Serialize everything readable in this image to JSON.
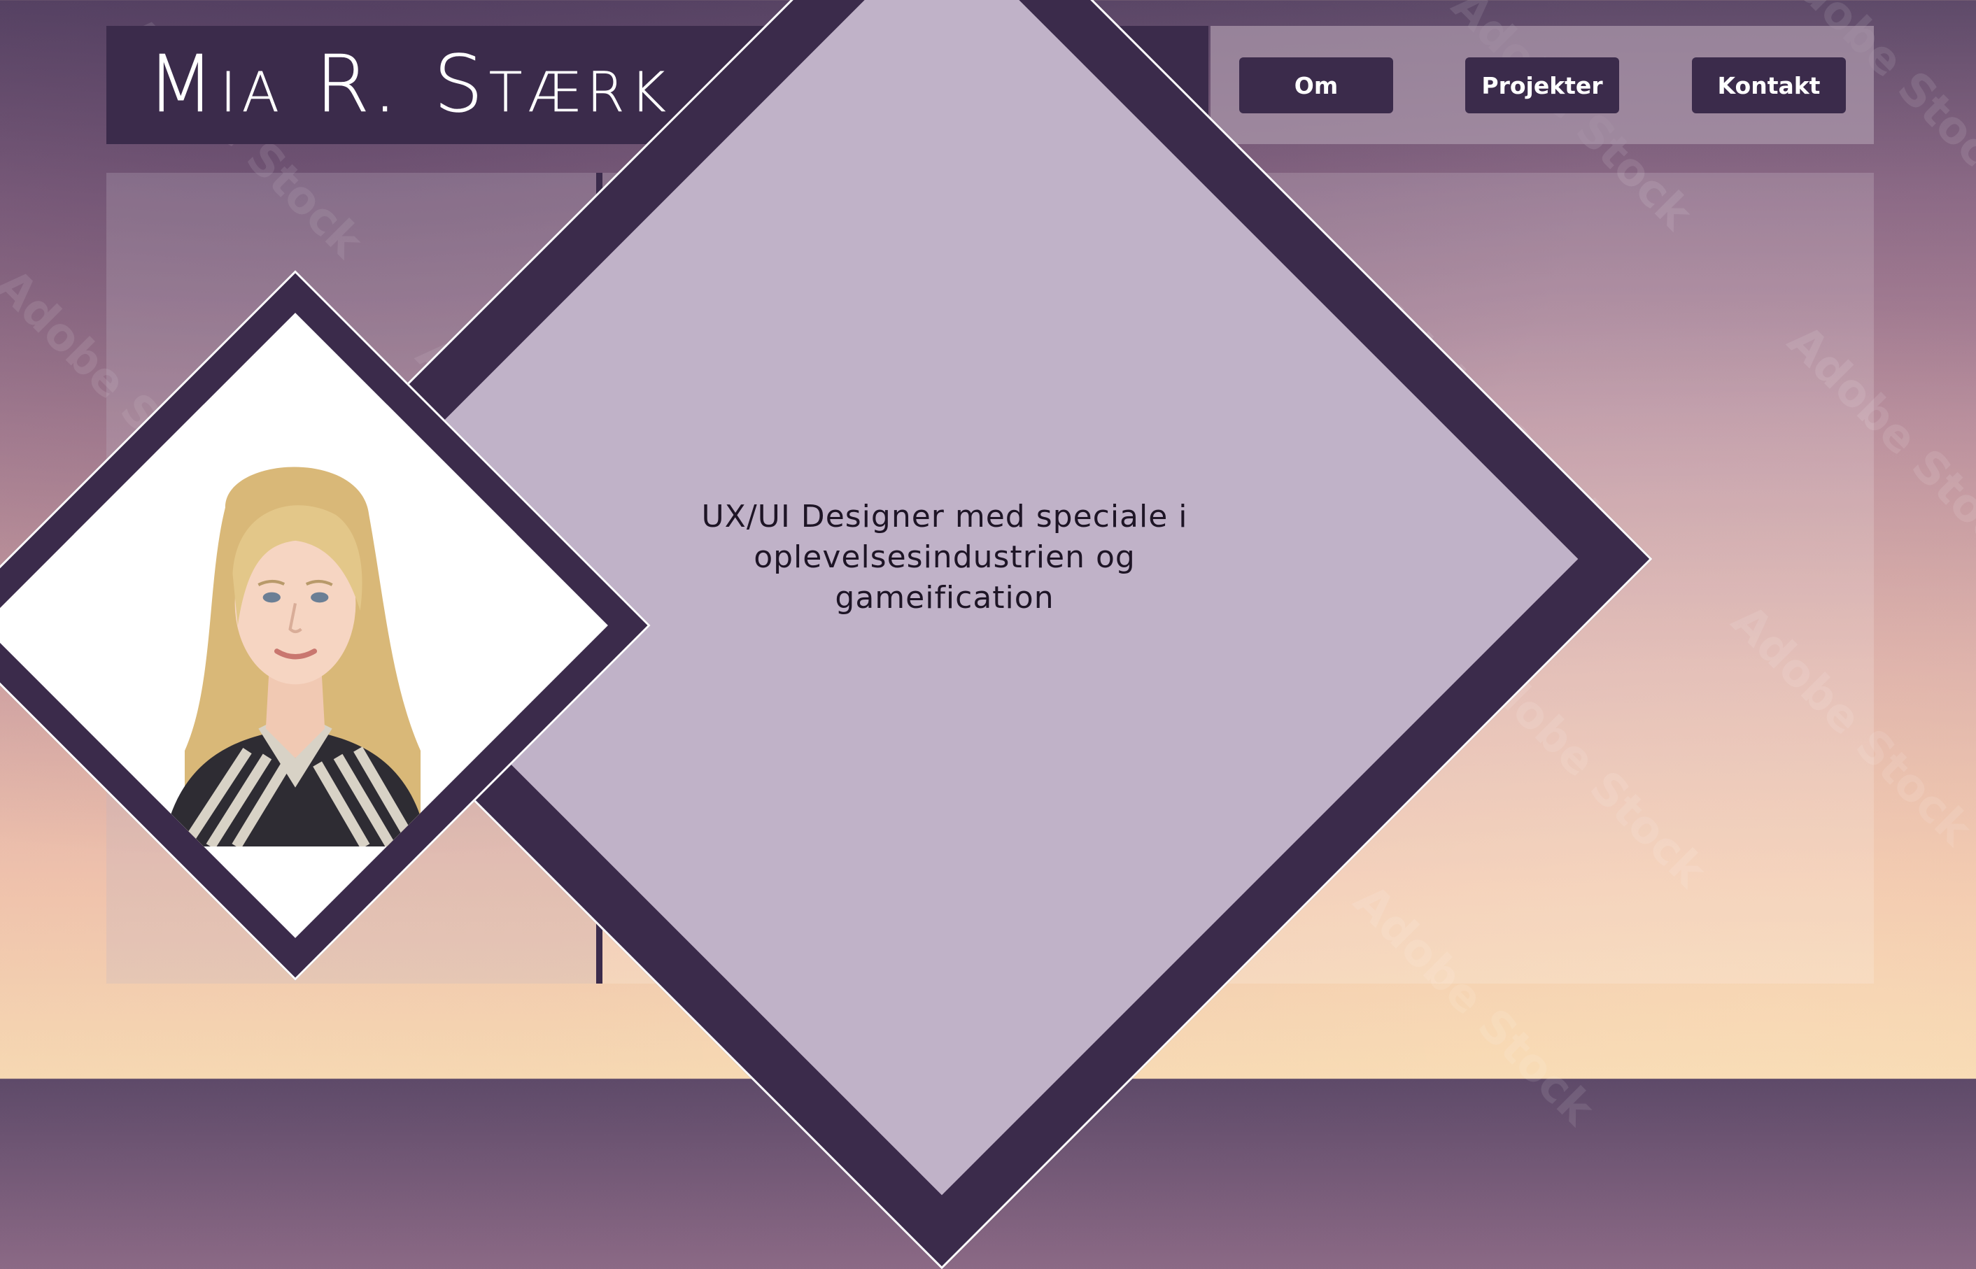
{
  "header": {
    "logo": "Mia R. Stærk",
    "nav": [
      {
        "label": "Om"
      },
      {
        "label": "Projekter"
      },
      {
        "label": "Kontakt"
      }
    ]
  },
  "hero": {
    "tagline": "UX/UI Designer med speciale i oplevelsesindustrien og gameification"
  },
  "portrait": {
    "alt": "Portrait photo"
  },
  "watermark": "Adobe Stock",
  "colors": {
    "primary": "#3b2b4b",
    "diamond_fill": "#c0b2c8",
    "text_dark": "#1e1526",
    "text_light": "#ffffff"
  }
}
